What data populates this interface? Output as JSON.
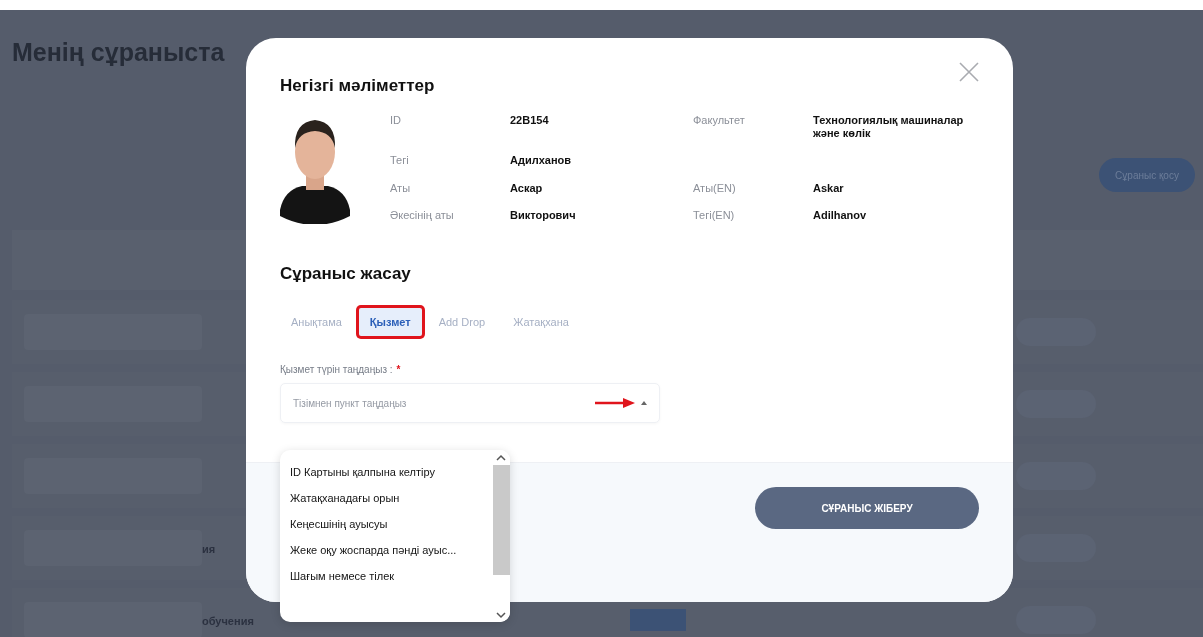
{
  "background": {
    "title": "Менің сұраныста",
    "add_button": "Сұраныс қосу",
    "rows": [
      {
        "kind": "plain"
      },
      {
        "kind": "plain"
      },
      {
        "kind": "plain"
      },
      {
        "kind": "plain",
        "text": "ия"
      },
      {
        "kind": "badged",
        "text": "обучения"
      }
    ]
  },
  "modal": {
    "info_title": "Негізгі мәліметтер",
    "photo": {
      "kind": "picture"
    },
    "info_rows": [
      [
        {
          "label": "ID",
          "value": "22B154"
        },
        {
          "label": "Факультет",
          "value": "Технологиялық машиналар және көлік"
        }
      ],
      [
        {
          "label": "Тегі",
          "value": "Адилханов"
        }
      ],
      [
        {
          "label": "Аты",
          "value": "Аскар"
        },
        {
          "label": "Аты(EN)",
          "value": "Askar"
        }
      ],
      [
        {
          "label": "Әкесінің аты",
          "value": "Викторович"
        },
        {
          "label": "Тегі(EN)",
          "value": "Adilhanov"
        }
      ]
    ],
    "request_title": "Сұраныс жасау",
    "tabs": [
      {
        "label": "Анықтама",
        "selected": false,
        "annotated": false
      },
      {
        "label": "Қызмет",
        "selected": true,
        "annotated": true
      },
      {
        "label": "Add Drop",
        "selected": false,
        "annotated": false
      },
      {
        "label": "Жатақхана",
        "selected": false,
        "annotated": false
      }
    ],
    "select": {
      "label": "Қызмет түрін таңдаңыз :",
      "required_mark": "*",
      "placeholder": "Тізімнен пункт таңдаңыз",
      "expanded": true,
      "arrow_annotation": true
    },
    "options": [
      "ID Картыны қалпына келтіру",
      "Жатақханадағы орын",
      "Кеңесшінің ауысуы",
      "Жеке оқу жоспарда пәнді ауыс...",
      "Шағым немесе тілек"
    ],
    "submit": "СҰРАНЫС ЖІБЕРУ"
  }
}
